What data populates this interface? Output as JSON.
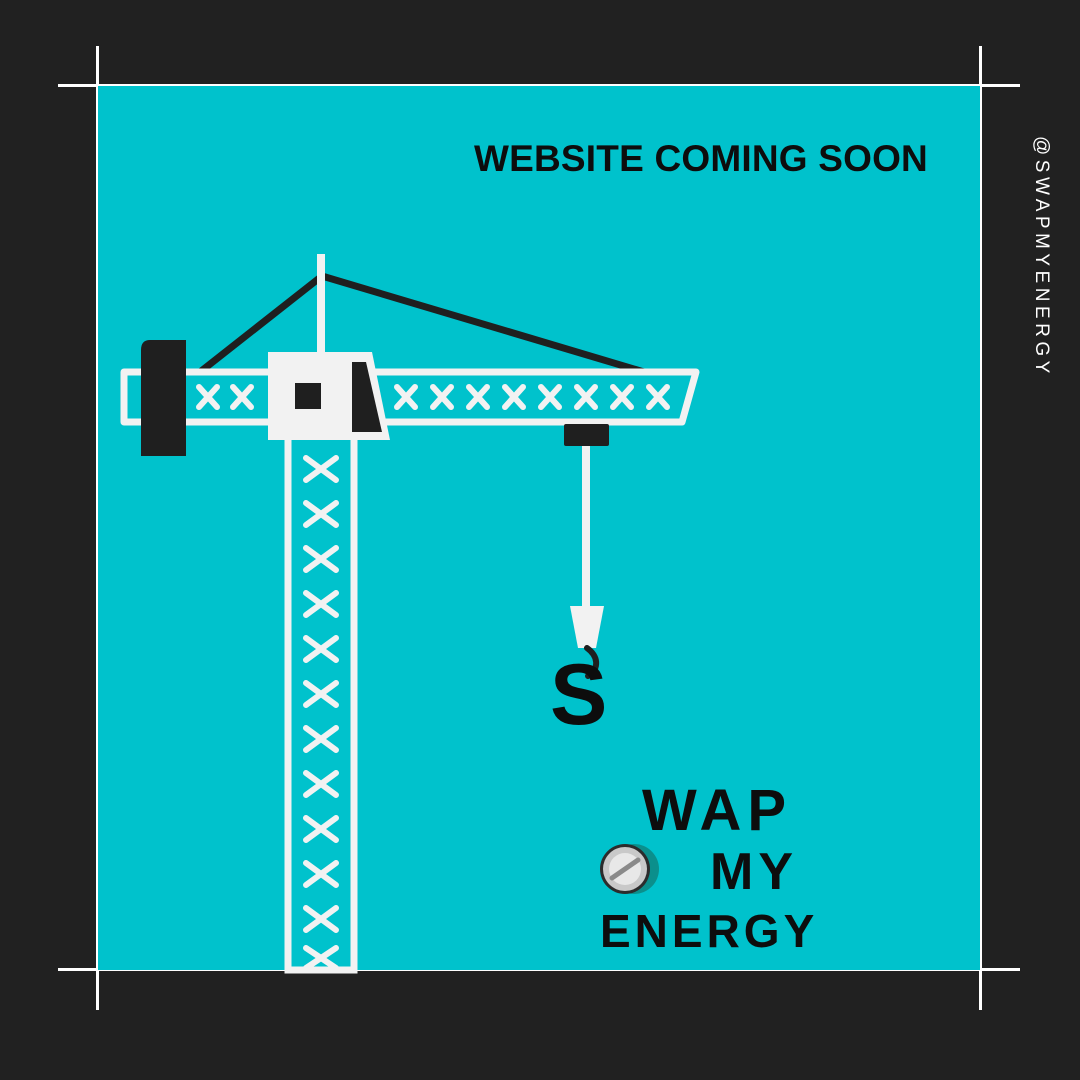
{
  "poster": {
    "heading": "WEBSITE COMING SOON",
    "handle": "@SWAPMYENERGY",
    "hook_letter": "S",
    "logo": {
      "line1": "WAP",
      "line2": "MY",
      "line3": "ENERGY",
      "icon": "dial-icon"
    },
    "illustration": "crane-icon"
  },
  "colors": {
    "background": "#212121",
    "panel": "#00c2cc",
    "ink": "#0d0d0d",
    "white": "#ffffff"
  }
}
